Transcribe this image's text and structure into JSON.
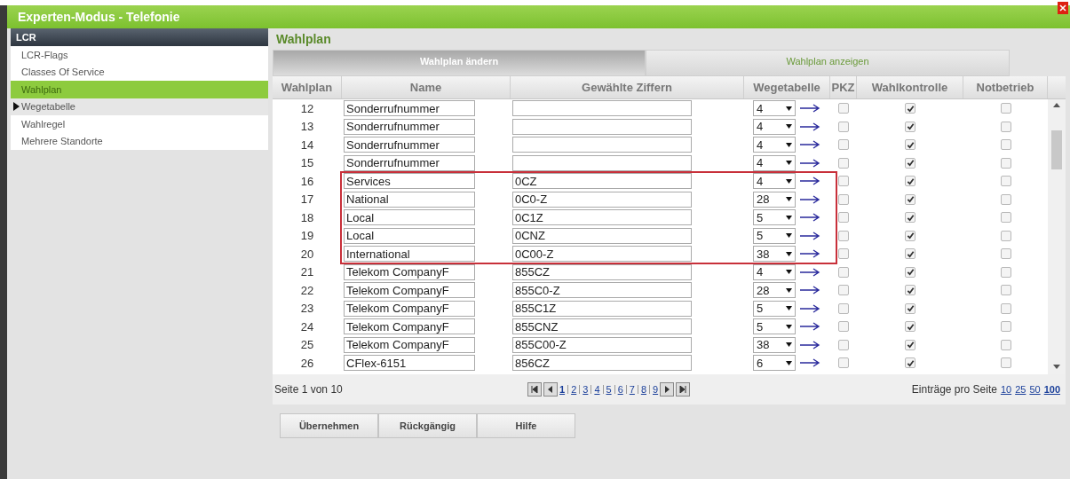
{
  "window": {
    "title": "Experten-Modus - Telefonie"
  },
  "sidebar": {
    "header": "LCR",
    "items": [
      {
        "label": "LCR-Flags",
        "selected": false,
        "pointer": false
      },
      {
        "label": "Classes Of Service",
        "selected": false,
        "pointer": false
      },
      {
        "label": "Wahlplan",
        "selected": true,
        "pointer": false
      },
      {
        "label": "Wegetabelle",
        "selected": false,
        "pointer": true
      },
      {
        "label": "Wahlregel",
        "selected": false,
        "pointer": false
      },
      {
        "label": "Mehrere Standorte",
        "selected": false,
        "pointer": false
      }
    ]
  },
  "page_title": "Wahlplan",
  "tabs": [
    {
      "label": "Wahlplan ändern",
      "selected": true
    },
    {
      "label": "Wahlplan anzeigen",
      "selected": false
    }
  ],
  "table": {
    "columns": [
      "Wahlplan",
      "Name",
      "Gewählte Ziffern",
      "Wegetabelle",
      "PKZ",
      "Wahlkontrolle",
      "Notbetrieb"
    ],
    "rows": [
      {
        "number": "12",
        "name": "Sonderrufnummer",
        "digits": "",
        "route": "4",
        "pkz": false,
        "control": true,
        "emergency": false,
        "highlighted": false
      },
      {
        "number": "13",
        "name": "Sonderrufnummer",
        "digits": "",
        "route": "4",
        "pkz": false,
        "control": true,
        "emergency": false,
        "highlighted": false
      },
      {
        "number": "14",
        "name": "Sonderrufnummer",
        "digits": "",
        "route": "4",
        "pkz": false,
        "control": true,
        "emergency": false,
        "highlighted": false
      },
      {
        "number": "15",
        "name": "Sonderrufnummer",
        "digits": "",
        "route": "4",
        "pkz": false,
        "control": true,
        "emergency": false,
        "highlighted": false
      },
      {
        "number": "16",
        "name": "Services",
        "digits": "0CZ",
        "route": "4",
        "pkz": false,
        "control": true,
        "emergency": false,
        "highlighted": true
      },
      {
        "number": "17",
        "name": "National",
        "digits": "0C0-Z",
        "route": "28",
        "pkz": false,
        "control": true,
        "emergency": false,
        "highlighted": true
      },
      {
        "number": "18",
        "name": "Local",
        "digits": "0C1Z",
        "route": "5",
        "pkz": false,
        "control": true,
        "emergency": false,
        "highlighted": true
      },
      {
        "number": "19",
        "name": "Local",
        "digits": "0CNZ",
        "route": "5",
        "pkz": false,
        "control": true,
        "emergency": false,
        "highlighted": true
      },
      {
        "number": "20",
        "name": "International",
        "digits": "0C00-Z",
        "route": "38",
        "pkz": false,
        "control": true,
        "emergency": false,
        "highlighted": true
      },
      {
        "number": "21",
        "name": "Telekom CompanyF",
        "digits": "855CZ",
        "route": "4",
        "pkz": false,
        "control": true,
        "emergency": false,
        "highlighted": false
      },
      {
        "number": "22",
        "name": "Telekom CompanyF",
        "digits": "855C0-Z",
        "route": "28",
        "pkz": false,
        "control": true,
        "emergency": false,
        "highlighted": false
      },
      {
        "number": "23",
        "name": "Telekom CompanyF",
        "digits": "855C1Z",
        "route": "5",
        "pkz": false,
        "control": true,
        "emergency": false,
        "highlighted": false
      },
      {
        "number": "24",
        "name": "Telekom CompanyF",
        "digits": "855CNZ",
        "route": "5",
        "pkz": false,
        "control": true,
        "emergency": false,
        "highlighted": false
      },
      {
        "number": "25",
        "name": "Telekom CompanyF",
        "digits": "855C00-Z",
        "route": "38",
        "pkz": false,
        "control": true,
        "emergency": false,
        "highlighted": false
      },
      {
        "number": "26",
        "name": "CFlex-6151",
        "digits": "856CZ",
        "route": "6",
        "pkz": false,
        "control": true,
        "emergency": false,
        "highlighted": false
      }
    ]
  },
  "pagination": {
    "summary": "Seite 1 von 10",
    "pages": [
      {
        "label": "1",
        "selected": true
      },
      {
        "label": "2",
        "selected": false
      },
      {
        "label": "3",
        "selected": false
      },
      {
        "label": "4",
        "selected": false
      },
      {
        "label": "5",
        "selected": false
      },
      {
        "label": "6",
        "selected": false
      },
      {
        "label": "7",
        "selected": false
      },
      {
        "label": "8",
        "selected": false
      },
      {
        "label": "9",
        "selected": false
      }
    ],
    "per_page_label": "Einträge pro Seite",
    "per_page": [
      {
        "label": "10",
        "selected": false
      },
      {
        "label": "25",
        "selected": false
      },
      {
        "label": "50",
        "selected": false
      },
      {
        "label": "100",
        "selected": true
      }
    ]
  },
  "buttons": [
    "Übernehmen",
    "Rückgängig",
    "Hilfe"
  ]
}
